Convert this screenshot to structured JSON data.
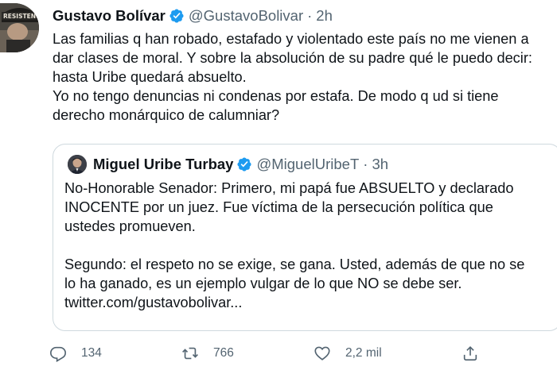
{
  "tweet": {
    "author": {
      "name": "Gustavo Bolívar",
      "handle": "@GustavoBolivar",
      "time": "2h",
      "avatar_text": "RESISTENCIA"
    },
    "separator": "·",
    "more": "···",
    "text_lines": [
      "Las familias q han robado, estafado y violentado este país no me vienen a",
      "dar clases de moral. Y sobre la absolución de su padre qué le puedo decir:",
      "hasta Uribe quedará absuelto.",
      "Yo no tengo denuncias ni condenas por estafa. De modo q ud si tiene",
      "derecho monárquico de calumniar?"
    ],
    "quoted": {
      "author": {
        "name": "Miguel Uribe Turbay",
        "handle": "@MiguelUribeT",
        "time": "3h"
      },
      "text_lines": [
        "No-Honorable Senador: Primero, mi papá fue ABSUELTO y declarado",
        "INOCENTE por un juez. Fue víctima de la persecución política que",
        "ustedes promueven.",
        "",
        "Segundo: el respeto no se exige, se gana. Usted, además de que no se",
        "lo ha ganado, es un ejemplo vulgar de lo que NO se debe ser.",
        "twitter.com/gustavobolivar..."
      ]
    },
    "actions": {
      "replies": "134",
      "retweets": "766",
      "likes": "2,2 mil"
    },
    "colors": {
      "verified": "#1d9bf0",
      "secondary_text": "#536471",
      "border": "#cfd9de"
    }
  }
}
